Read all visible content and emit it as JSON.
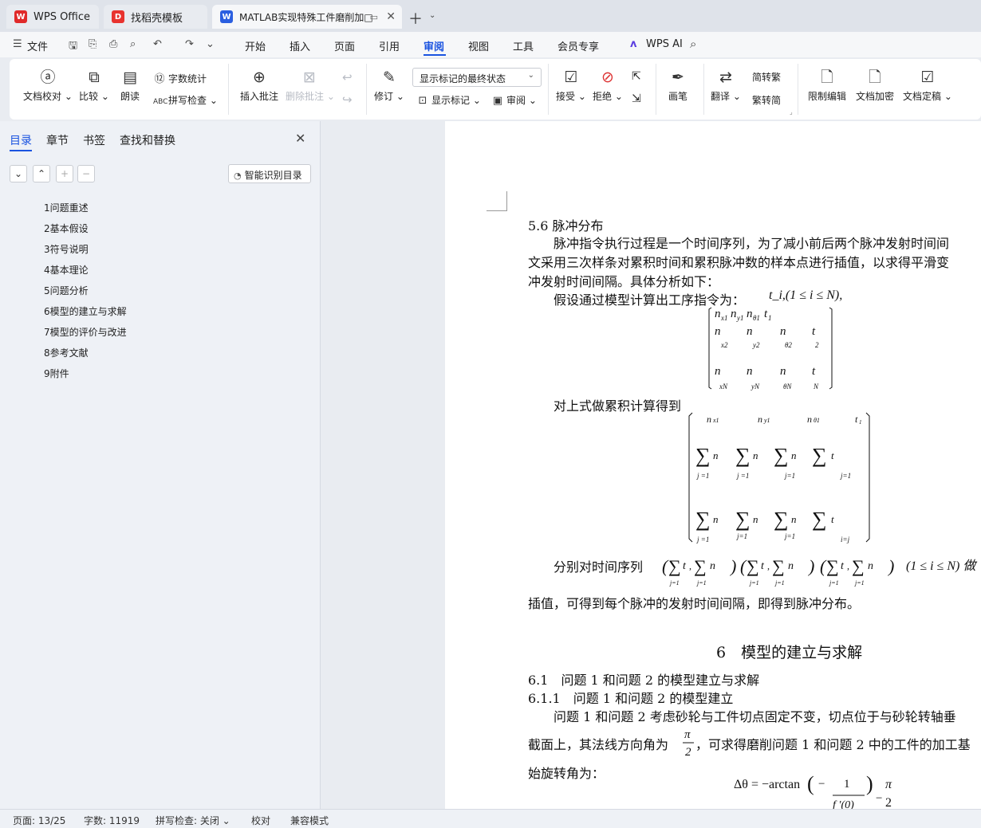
{
  "tabs": [
    {
      "label": "WPS Office",
      "icon": "wps-logo-icon",
      "color": "#e02a2a"
    },
    {
      "label": "找稻壳模板",
      "icon": "docer-icon",
      "color": "#e8332f"
    },
    {
      "label": "MATLAB实现特殊工件磨削加□",
      "icon": "word-doc-icon",
      "color": "#2b5fe0"
    }
  ],
  "menu": {
    "file": "文件",
    "items": [
      "开始",
      "插入",
      "页面",
      "引用",
      "审阅",
      "视图",
      "工具",
      "会员专享"
    ],
    "active": "审阅",
    "wps_ai": "WPS AI"
  },
  "ribbon": {
    "doc_check": "文档校对",
    "compare": "比较",
    "read_aloud": "朗读",
    "word_count": "字数统计",
    "spell_check": "拼写检查",
    "insert_comment": "插入批注",
    "delete_comment": "删除批注",
    "track": "修订",
    "markup_state": "显示标记的最终状态",
    "show_markup": "显示标记",
    "review": "审阅",
    "accept": "接受",
    "reject": "拒绝",
    "pen": "画笔",
    "translate": "翻译",
    "to_traditional": "简转繁",
    "to_simplified": "繁转简",
    "restrict_edit": "限制编辑",
    "encrypt": "文档加密",
    "finalize": "文档定稿"
  },
  "nav": {
    "tabs": [
      "目录",
      "章节",
      "书签",
      "查找和替换"
    ],
    "smart_toc": "智能识别目录",
    "toc": [
      "1问题重述",
      "2基本假设",
      "3符号说明",
      "4基本理论",
      "5问题分析",
      "6模型的建立与求解",
      "7模型的评价与改进",
      "8参考文献",
      "9附件"
    ]
  },
  "doc": {
    "sec56": "5.6 脉冲分布",
    "para1_l1": "脉冲指令执行过程是一个时间序列，为了减小前后两个脉冲发射时间间",
    "para1_l2": "文采用三次样条对累积时间和累积脉冲数的样本点进行插值，以求得平滑变",
    "para1_l3": "冲发射时间间隔。具体分析如下：",
    "assume": "假设通过模型计算出工序指令为：",
    "assume_math": "t_i,(1 ≤ i ≤ N),",
    "accum": "对上式做累积计算得到",
    "interp_l1": "分别对时间序列",
    "interp_math": "(1 ≤ i ≤ N) 做",
    "interp_l2": "插值，可得到每个脉冲的发射时间间隔，即得到脉冲分布。",
    "ch6": "6　模型的建立与求解",
    "sec61": "6.1　问题 1 和问题 2 的模型建立与求解",
    "sec611": "6.1.1　问题 1 和问题 2 的模型建立",
    "body1": "问题 1 和问题 2 考虑砂轮与工件切点固定不变，切点位于与砂轮转轴垂",
    "body2a": "截面上，其法线方向角为",
    "body2b": "，可求得磨削问题 1 和问题 2 中的工件的加工基",
    "body3": "始旋转角为：",
    "eq_delta": "Δθ = −arctan",
    "eq_pi": "π",
    "eq_2": "2"
  },
  "status": {
    "page": "页面: 13/25",
    "words": "字数: 11919",
    "spell": "拼写检查: 关闭",
    "proof": "校对",
    "compat": "兼容模式"
  }
}
